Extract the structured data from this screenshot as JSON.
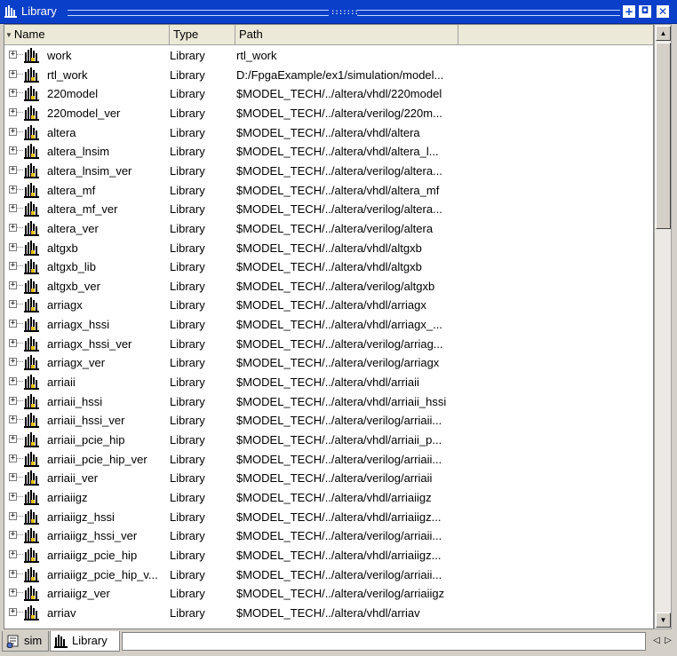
{
  "window": {
    "title": "Library"
  },
  "columns": {
    "name": "Name",
    "type": "Type",
    "path": "Path"
  },
  "rows": [
    {
      "name": "work",
      "type": "Library",
      "path": "rtl_work"
    },
    {
      "name": "rtl_work",
      "type": "Library",
      "path": "D:/FpgaExample/ex1/simulation/model..."
    },
    {
      "name": "220model",
      "type": "Library",
      "path": "$MODEL_TECH/../altera/vhdl/220model"
    },
    {
      "name": "220model_ver",
      "type": "Library",
      "path": "$MODEL_TECH/../altera/verilog/220m..."
    },
    {
      "name": "altera",
      "type": "Library",
      "path": "$MODEL_TECH/../altera/vhdl/altera"
    },
    {
      "name": "altera_lnsim",
      "type": "Library",
      "path": "$MODEL_TECH/../altera/vhdl/altera_l..."
    },
    {
      "name": "altera_lnsim_ver",
      "type": "Library",
      "path": "$MODEL_TECH/../altera/verilog/altera..."
    },
    {
      "name": "altera_mf",
      "type": "Library",
      "path": "$MODEL_TECH/../altera/vhdl/altera_mf"
    },
    {
      "name": "altera_mf_ver",
      "type": "Library",
      "path": "$MODEL_TECH/../altera/verilog/altera..."
    },
    {
      "name": "altera_ver",
      "type": "Library",
      "path": "$MODEL_TECH/../altera/verilog/altera"
    },
    {
      "name": "altgxb",
      "type": "Library",
      "path": "$MODEL_TECH/../altera/vhdl/altgxb"
    },
    {
      "name": "altgxb_lib",
      "type": "Library",
      "path": "$MODEL_TECH/../altera/vhdl/altgxb"
    },
    {
      "name": "altgxb_ver",
      "type": "Library",
      "path": "$MODEL_TECH/../altera/verilog/altgxb"
    },
    {
      "name": "arriagx",
      "type": "Library",
      "path": "$MODEL_TECH/../altera/vhdl/arriagx"
    },
    {
      "name": "arriagx_hssi",
      "type": "Library",
      "path": "$MODEL_TECH/../altera/vhdl/arriagx_..."
    },
    {
      "name": "arriagx_hssi_ver",
      "type": "Library",
      "path": "$MODEL_TECH/../altera/verilog/arriag..."
    },
    {
      "name": "arriagx_ver",
      "type": "Library",
      "path": "$MODEL_TECH/../altera/verilog/arriagx"
    },
    {
      "name": "arriaii",
      "type": "Library",
      "path": "$MODEL_TECH/../altera/vhdl/arriaii"
    },
    {
      "name": "arriaii_hssi",
      "type": "Library",
      "path": "$MODEL_TECH/../altera/vhdl/arriaii_hssi"
    },
    {
      "name": "arriaii_hssi_ver",
      "type": "Library",
      "path": "$MODEL_TECH/../altera/verilog/arriaii..."
    },
    {
      "name": "arriaii_pcie_hip",
      "type": "Library",
      "path": "$MODEL_TECH/../altera/vhdl/arriaii_p..."
    },
    {
      "name": "arriaii_pcie_hip_ver",
      "type": "Library",
      "path": "$MODEL_TECH/../altera/verilog/arriaii..."
    },
    {
      "name": "arriaii_ver",
      "type": "Library",
      "path": "$MODEL_TECH/../altera/verilog/arriaii"
    },
    {
      "name": "arriaiigz",
      "type": "Library",
      "path": "$MODEL_TECH/../altera/vhdl/arriaiigz"
    },
    {
      "name": "arriaiigz_hssi",
      "type": "Library",
      "path": "$MODEL_TECH/../altera/vhdl/arriaiigz..."
    },
    {
      "name": "arriaiigz_hssi_ver",
      "type": "Library",
      "path": "$MODEL_TECH/../altera/verilog/arriaii..."
    },
    {
      "name": "arriaiigz_pcie_hip",
      "type": "Library",
      "path": "$MODEL_TECH/../altera/vhdl/arriaiigz..."
    },
    {
      "name": "arriaiigz_pcie_hip_v...",
      "type": "Library",
      "path": "$MODEL_TECH/../altera/verilog/arriaii..."
    },
    {
      "name": "arriaiigz_ver",
      "type": "Library",
      "path": "$MODEL_TECH/../altera/verilog/arriaiigz"
    },
    {
      "name": "arriav",
      "type": "Library",
      "path": "$MODEL_TECH/../altera/vhdl/arriav"
    }
  ],
  "tabs": [
    {
      "label": "sim",
      "icon": "sim-icon",
      "active": false
    },
    {
      "label": "Library",
      "icon": "library-icon",
      "active": true
    }
  ],
  "colors": {
    "titlebar": "#0a3fc9",
    "library_icon": "#000000",
    "background": "#d4d0c8"
  }
}
